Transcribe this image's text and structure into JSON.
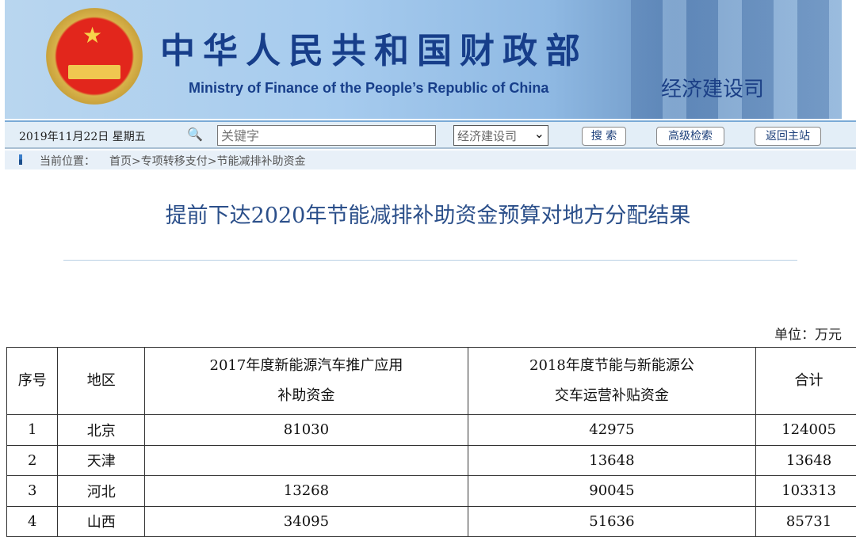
{
  "banner": {
    "title_cn": "中华人民共和国财政部",
    "title_en": "Ministry of Finance of the People’s Republic of China",
    "department": "经济建设司"
  },
  "toolbar": {
    "date": "2019年11月22日  星期五",
    "search_placeholder": "关键字",
    "scope_selected": "经济建设司",
    "search_label": "搜 索",
    "advanced_label": "高级检索",
    "home_label": "返回主站"
  },
  "breadcrumb": {
    "label": "当前位置：",
    "path": "首页>专项转移支付>节能减排补助资金"
  },
  "article": {
    "title": "提前下达2020年节能减排补助资金预算对地方分配结果",
    "unit": "单位：万元"
  },
  "table": {
    "headers": [
      "序号",
      "地区",
      "2017年度新能源汽车推广应用补助资金",
      "2018年度节能与新能源公交车运营补贴资金",
      "合计"
    ],
    "header_lines": {
      "c2a": "2017年度新能源汽车推广应用",
      "c2b": "补助资金",
      "c3a": "2018年度节能与新能源公",
      "c3b": "交车运营补贴资金"
    },
    "rows": [
      [
        "1",
        "北京",
        "81030",
        "42975",
        "124005"
      ],
      [
        "2",
        "天津",
        "",
        "13648",
        "13648"
      ],
      [
        "3",
        "河北",
        "13268",
        "90045",
        "103313"
      ],
      [
        "4",
        "山西",
        "34095",
        "51636",
        "85731"
      ]
    ]
  }
}
